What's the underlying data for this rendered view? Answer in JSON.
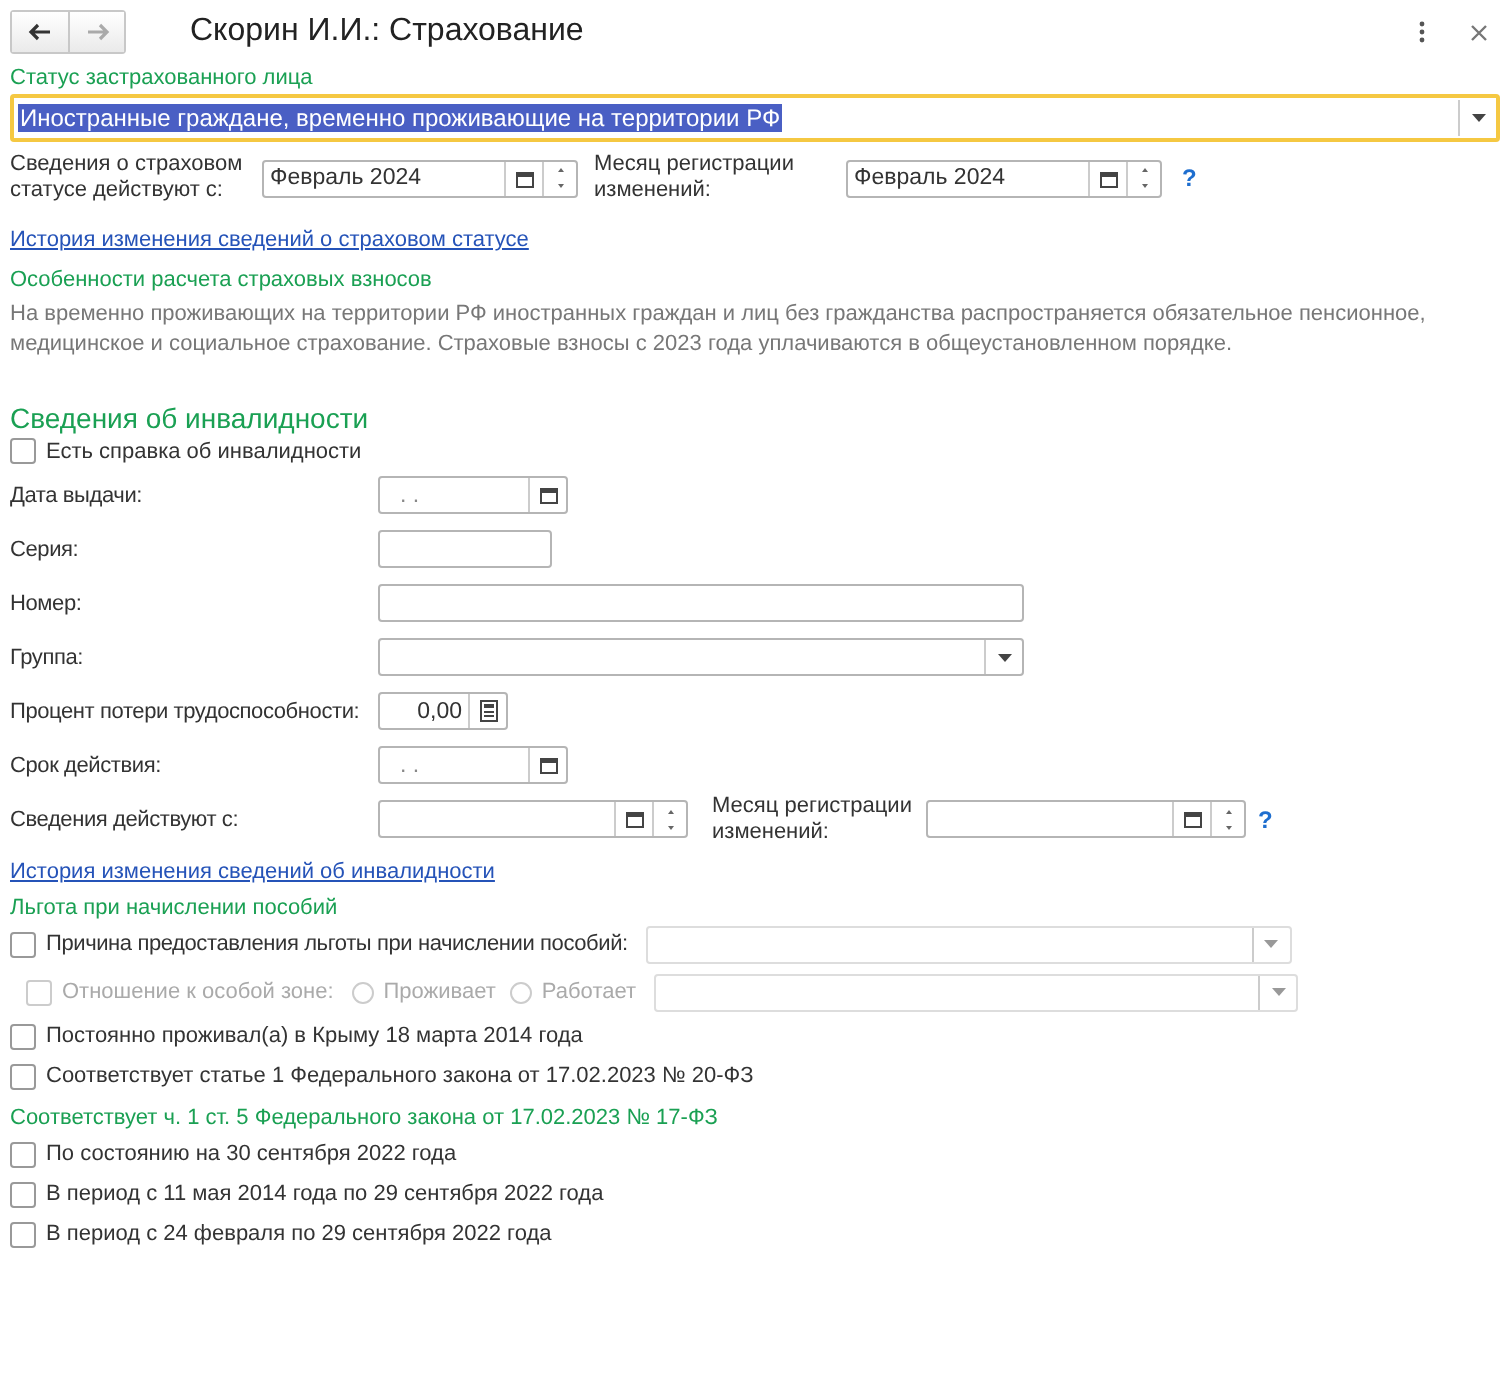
{
  "window": {
    "title": "Скорин И.И.: Страхование"
  },
  "insured_status": {
    "label": "Статус застрахованного лица",
    "value": "Иностранные граждане, временно проживающие на территории РФ",
    "selected": true
  },
  "status_dates": [
    {
      "label": "Сведения о страховом статусе действуют с:",
      "value": "Февраль 2024"
    },
    {
      "label": "Месяц регистрации изменений:",
      "value": "Февраль 2024"
    }
  ],
  "status_help": "?",
  "status_history_link": "История изменения сведений о страховом статусе",
  "contributions": {
    "heading": "Особенности расчета страховых взносов",
    "text": "На временно проживающих на территории РФ иностранных граждан и лиц без гражданства распространяется обязательное пенсионное, медицинское и социальное страхование. Страховые взносы с 2023 года уплачиваются в общеустановленном порядке."
  },
  "disability": {
    "heading": "Сведения об инвалидности",
    "certificate": {
      "label": "Есть справка об инвалидности",
      "checked": false
    },
    "fields": [
      {
        "kind": "date",
        "label": "Дата выдачи:",
        "placeholder": ".  ."
      },
      {
        "kind": "short",
        "label": "Серия:"
      },
      {
        "kind": "long",
        "label": "Номер:"
      },
      {
        "kind": "select",
        "label": "Группа:"
      },
      {
        "kind": "number",
        "label": "Процент потери трудоспособности:",
        "value": "0,00"
      },
      {
        "kind": "date",
        "label": "Срок действия:",
        "placeholder": ".  ."
      }
    ],
    "period": [
      {
        "label": "Сведения действуют с:"
      },
      {
        "label": "Месяц регистрации изменений:"
      }
    ],
    "help": "?",
    "history_link": "История изменения сведений об инвалидности"
  },
  "benefits": {
    "heading": "Льгота при начислении пособий",
    "reason": {
      "label": "Причина предоставления льготы при начислении пособий:",
      "checked": false
    },
    "zone": {
      "label": "Отношение к особой зоне:",
      "checked": false,
      "disabled": true,
      "options": [
        {
          "label": "Проживает",
          "selected": false
        },
        {
          "label": "Работает",
          "selected": false
        }
      ]
    },
    "checks": [
      {
        "label": "Постоянно проживал(а) в Крыму 18 марта 2014 года",
        "checked": false
      },
      {
        "label": "Соответствует статье 1 Федерального закона от 17.02.2023 № 20-ФЗ",
        "checked": false
      }
    ]
  },
  "law17": {
    "heading": "Соответствует ч. 1 ст. 5 Федерального закона от 17.02.2023 № 17-ФЗ",
    "checks": [
      {
        "label": "По состоянию на 30 сентября 2022 года",
        "checked": false
      },
      {
        "label": "В период с 11 мая 2014 года по 29 сентября 2022 года",
        "checked": false
      },
      {
        "label": "В период с 24 февраля по 29 сентября 2022 года",
        "checked": false
      }
    ]
  }
}
